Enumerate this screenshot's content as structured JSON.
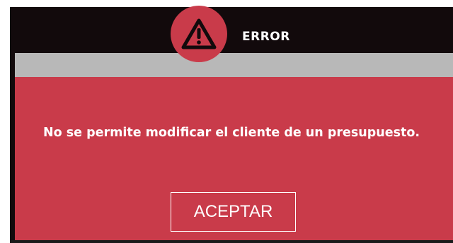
{
  "dialog": {
    "title": "ERROR",
    "icon": "warning-triangle-icon",
    "message": "No se permite modificar el cliente de un presupuesto.",
    "accept_label": "ACEPTAR"
  },
  "colors": {
    "dialog_bg": "#c93b4a",
    "header_bg": "#120a0c",
    "strip_bg": "#b8b8b8",
    "text": "#ffffff"
  }
}
